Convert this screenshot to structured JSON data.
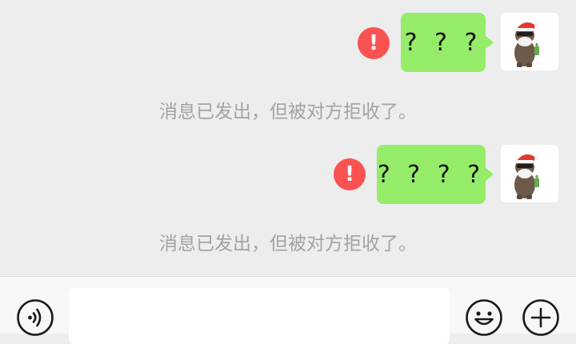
{
  "messages": [
    {
      "text": "? ? ?",
      "status_icon": "error-exclamation-icon",
      "error_glyph": "!",
      "system_notice": "消息已发出，但被对方拒收了。"
    },
    {
      "text": "? ? ? ?",
      "status_icon": "error-exclamation-icon",
      "error_glyph": "!",
      "system_notice": "消息已发出，但被对方拒收了。"
    }
  ],
  "avatar": {
    "icon": "bear-with-santa-hat-avatar"
  },
  "input_bar": {
    "voice_icon": "voice-icon",
    "text_value": "",
    "emoji_icon": "emoji-icon",
    "more_icon": "plus-icon"
  },
  "colors": {
    "background": "#ededed",
    "bubble": "#95ec69",
    "error": "#fa5151",
    "notice_text": "#a3a3a3",
    "bottom_bar": "#f7f7f7"
  }
}
